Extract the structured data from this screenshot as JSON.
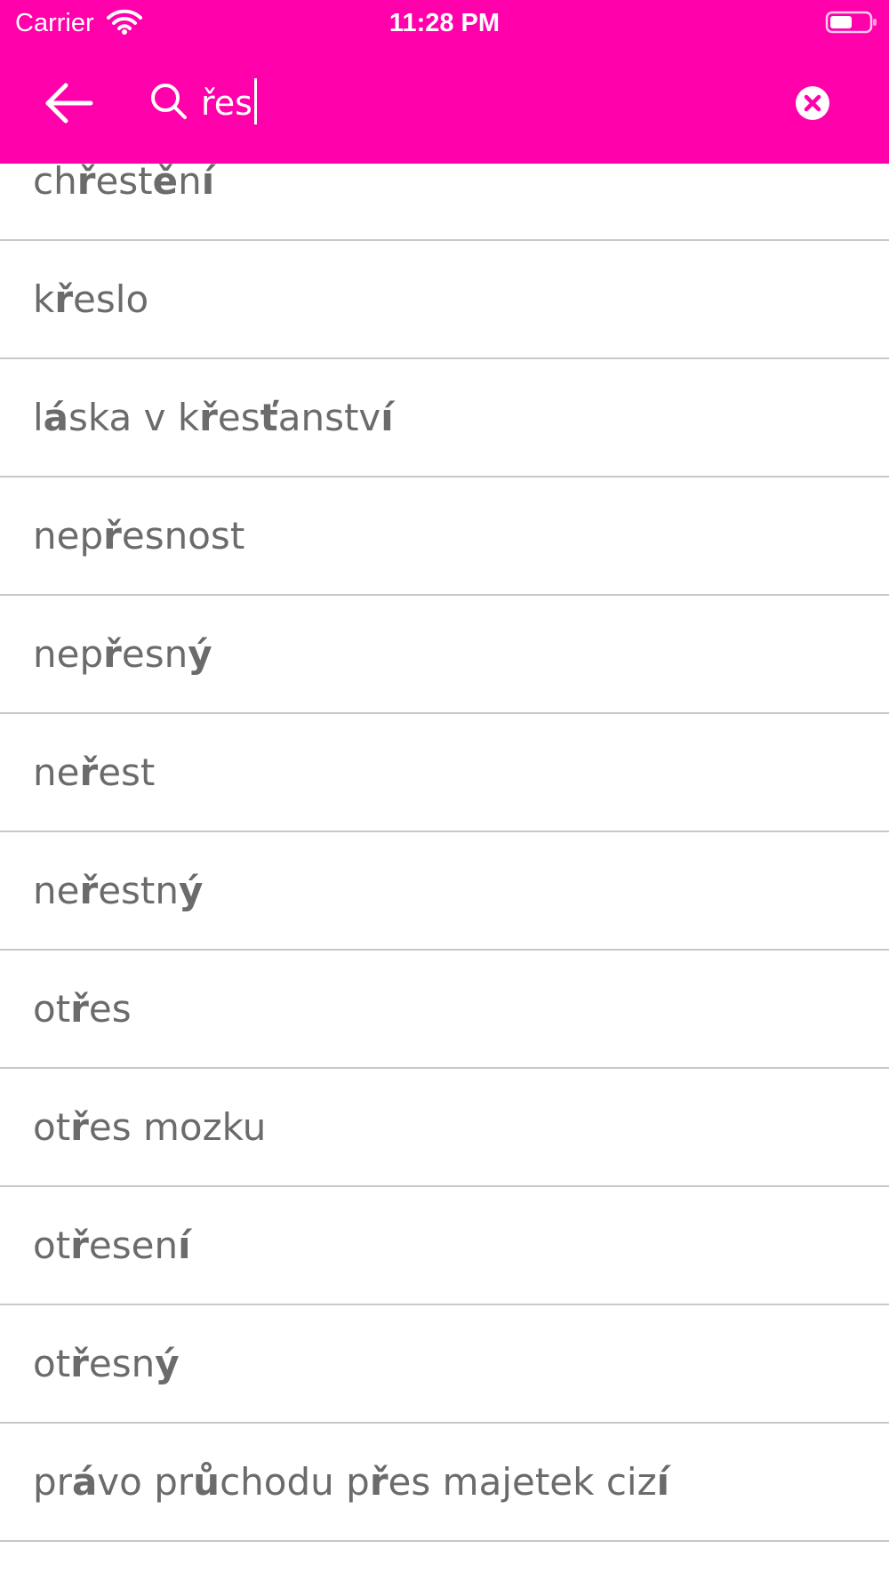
{
  "status_bar": {
    "carrier": "Carrier",
    "time": "11:28 PM"
  },
  "search_bar": {
    "query": "řes",
    "icons": [
      "back-arrow-icon",
      "search-icon",
      "clear-icon"
    ]
  },
  "results": [
    "chřestění",
    "křeslo",
    "láska v křesťanství",
    "nepřesnost",
    "nepřesný",
    "neřest",
    "neřestný",
    "otřes",
    "otřes mozku",
    "otřesení",
    "otřesný",
    "právo průchodu přes majetek cizí"
  ],
  "colors": {
    "accent": "#ff00aa",
    "text": "#6b6b6b",
    "divider": "#c8c8c8"
  }
}
